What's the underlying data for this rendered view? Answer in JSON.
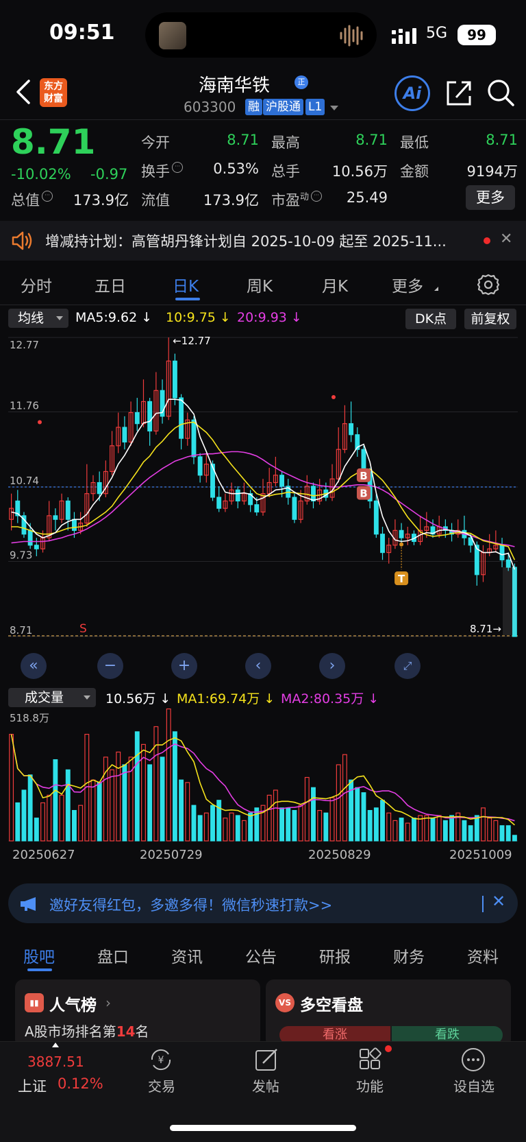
{
  "status_bar": {
    "time": "09:51",
    "network": "5G",
    "battery": "99"
  },
  "header": {
    "logo_text_1": "东方",
    "logo_text_2": "财富",
    "stock_name": "海南华铁",
    "name_badge": "正",
    "stock_code": "603300",
    "tags": [
      "融",
      "沪股通",
      "L1"
    ],
    "ai_label": "Ai"
  },
  "quote": {
    "price": "8.71",
    "change_pct": "-10.02%",
    "change": "-0.97",
    "fields": [
      {
        "label": "今开",
        "value": "8.71",
        "color": "green"
      },
      {
        "label": "最高",
        "value": "8.71",
        "color": "green"
      },
      {
        "label": "最低",
        "value": "8.71",
        "color": "green"
      },
      {
        "label": "换手",
        "value": "0.53%",
        "color": "white"
      },
      {
        "label": "总手",
        "value": "10.56万",
        "color": "white"
      },
      {
        "label": "金额",
        "value": "9194万",
        "color": "white"
      },
      {
        "label": "总值",
        "value": "173.9亿",
        "color": "white"
      },
      {
        "label": "流值",
        "value": "173.9亿",
        "color": "white"
      },
      {
        "label": "市盈",
        "label_sup": "动",
        "value": "25.49",
        "color": "white"
      }
    ],
    "more_label": "更多"
  },
  "notice": {
    "text": "增减持计划：高管胡丹锋计划自 2025-10-09 起至 2025-11..."
  },
  "period_tabs": [
    "分时",
    "五日",
    "日K",
    "周K",
    "月K",
    "更多"
  ],
  "active_period": "日K",
  "ma_bar": {
    "selector": "均线",
    "ma5": "MA5:9.62 ↓",
    "ma10": "10:9.75 ↓",
    "ma20": "20:9.93 ↓",
    "dk": "DK点",
    "adjust": "前复权"
  },
  "chart_data": {
    "type": "candlestick",
    "y_ticks": [
      "12.77",
      "11.76",
      "10.74",
      "9.73",
      "8.71"
    ],
    "ylim": [
      8.71,
      12.77
    ],
    "ref_price": 10.74,
    "high_marker": "←12.77",
    "last_marker": "8.71→",
    "dates": [
      "20250627",
      "20250729",
      "20250829",
      "20251009"
    ],
    "candles": [
      [
        10.3,
        10.45,
        10.65,
        10.15
      ],
      [
        10.55,
        10.35,
        10.7,
        10.25
      ],
      [
        10.35,
        10.1,
        10.4,
        10.05
      ],
      [
        10.15,
        9.95,
        10.25,
        9.9
      ],
      [
        9.95,
        9.9,
        10.05,
        9.8
      ],
      [
        9.9,
        10.05,
        10.15,
        9.85
      ],
      [
        10.05,
        10.35,
        10.55,
        10.0
      ],
      [
        10.35,
        10.3,
        10.45,
        10.15
      ],
      [
        10.3,
        10.55,
        10.65,
        10.25
      ],
      [
        10.55,
        10.3,
        10.6,
        10.15
      ],
      [
        10.3,
        10.15,
        10.4,
        10.05
      ],
      [
        10.15,
        10.25,
        10.4,
        10.1
      ],
      [
        10.25,
        10.65,
        11.05,
        10.2
      ],
      [
        10.65,
        10.8,
        10.9,
        10.55
      ],
      [
        10.8,
        10.65,
        10.95,
        10.55
      ],
      [
        10.65,
        10.95,
        11.1,
        10.6
      ],
      [
        10.95,
        11.3,
        11.5,
        10.9
      ],
      [
        11.3,
        11.55,
        11.75,
        11.2
      ],
      [
        11.55,
        11.35,
        11.7,
        11.25
      ],
      [
        11.35,
        11.75,
        11.9,
        11.3
      ],
      [
        11.75,
        11.6,
        11.95,
        11.5
      ],
      [
        11.6,
        11.9,
        12.2,
        11.55
      ],
      [
        11.9,
        11.5,
        11.95,
        11.3
      ],
      [
        11.5,
        12.05,
        12.3,
        11.45
      ],
      [
        12.05,
        11.7,
        12.2,
        11.6
      ],
      [
        11.7,
        12.45,
        12.77,
        11.65
      ],
      [
        12.45,
        11.95,
        12.55,
        11.85
      ],
      [
        11.95,
        11.4,
        12.0,
        11.25
      ],
      [
        11.4,
        11.65,
        11.75,
        11.3
      ],
      [
        11.65,
        11.15,
        11.7,
        11.05
      ],
      [
        11.15,
        10.9,
        11.2,
        10.8
      ],
      [
        10.9,
        11.05,
        11.2,
        10.8
      ],
      [
        11.05,
        10.6,
        11.1,
        10.55
      ],
      [
        10.6,
        10.45,
        10.75,
        10.4
      ],
      [
        10.45,
        10.55,
        10.65,
        10.4
      ],
      [
        10.55,
        10.7,
        10.8,
        10.5
      ],
      [
        10.7,
        10.55,
        10.75,
        10.45
      ],
      [
        10.55,
        10.65,
        10.8,
        10.5
      ],
      [
        10.65,
        10.5,
        10.7,
        10.4
      ],
      [
        10.5,
        10.4,
        10.6,
        10.35
      ],
      [
        10.4,
        10.65,
        10.85,
        10.35
      ],
      [
        10.65,
        10.8,
        11.0,
        10.6
      ],
      [
        10.8,
        10.9,
        11.15,
        10.75
      ],
      [
        10.9,
        10.75,
        10.95,
        10.6
      ],
      [
        10.75,
        10.6,
        10.85,
        10.5
      ],
      [
        10.6,
        10.3,
        10.65,
        10.25
      ],
      [
        10.3,
        10.55,
        10.7,
        10.25
      ],
      [
        10.55,
        10.75,
        10.9,
        10.5
      ],
      [
        10.75,
        10.55,
        10.8,
        10.45
      ],
      [
        10.55,
        10.7,
        10.85,
        10.5
      ],
      [
        10.7,
        10.6,
        10.8,
        10.55
      ],
      [
        10.6,
        10.85,
        11.05,
        10.55
      ],
      [
        10.85,
        11.25,
        11.55,
        10.8
      ],
      [
        11.25,
        11.6,
        11.85,
        11.2
      ],
      [
        11.6,
        11.45,
        11.9,
        11.35
      ],
      [
        11.45,
        11.25,
        11.55,
        11.15
      ],
      [
        11.25,
        10.95,
        11.3,
        10.85
      ],
      [
        10.95,
        10.55,
        11.0,
        10.45
      ],
      [
        10.55,
        10.1,
        10.65,
        10.05
      ],
      [
        10.1,
        9.85,
        10.2,
        9.75
      ],
      [
        9.85,
        9.95,
        10.05,
        9.7
      ],
      [
        9.95,
        10.15,
        10.3,
        9.9
      ],
      [
        10.15,
        10.05,
        10.25,
        9.95
      ],
      [
        10.05,
        10.1,
        10.2,
        9.95
      ],
      [
        10.1,
        10.0,
        10.15,
        9.95
      ],
      [
        10.0,
        10.15,
        10.35,
        9.95
      ],
      [
        10.15,
        10.2,
        10.4,
        10.05
      ],
      [
        10.2,
        10.1,
        10.3,
        10.05
      ],
      [
        10.1,
        10.2,
        10.35,
        10.05
      ],
      [
        10.2,
        10.15,
        10.3,
        10.05
      ],
      [
        10.15,
        10.1,
        10.25,
        10.0
      ],
      [
        10.1,
        10.15,
        10.3,
        10.05
      ],
      [
        10.15,
        10.05,
        10.35,
        9.95
      ],
      [
        10.05,
        9.95,
        10.1,
        9.85
      ],
      [
        9.95,
        9.55,
        10.0,
        9.4
      ],
      [
        9.55,
        9.85,
        9.95,
        9.45
      ],
      [
        9.85,
        9.9,
        10.1,
        9.8
      ],
      [
        9.9,
        9.95,
        10.15,
        9.85
      ],
      [
        9.95,
        9.75,
        10.05,
        9.65
      ],
      [
        9.75,
        9.65,
        9.85,
        9.6
      ],
      [
        9.65,
        8.71,
        9.7,
        8.71
      ]
    ],
    "ma5": [
      10.4,
      10.38,
      10.3,
      10.2,
      10.1,
      10.05,
      10.08,
      10.12,
      10.22,
      10.27,
      10.3,
      10.3,
      10.37,
      10.5,
      10.6,
      10.73,
      10.87,
      11.05,
      11.17,
      11.32,
      11.48,
      11.61,
      11.63,
      11.74,
      11.75,
      11.93,
      11.93,
      11.92,
      11.84,
      11.73,
      11.42,
      11.22,
      11.01,
      10.82,
      10.67,
      10.65,
      10.65,
      10.66,
      10.64,
      10.56,
      10.59,
      10.64,
      10.7,
      10.71,
      10.73,
      10.67,
      10.62,
      10.59,
      10.56,
      10.58,
      10.63,
      10.69,
      10.82,
      11.02,
      11.15,
      11.28,
      11.32,
      11.08,
      10.66,
      10.34,
      10.14,
      10.02,
      10.0,
      10.01,
      10.04,
      10.09,
      10.12,
      10.11,
      10.15,
      10.16,
      10.15,
      10.14,
      10.12,
      10.08,
      9.9,
      9.85,
      9.85,
      9.86,
      9.82,
      9.84,
      9.62
    ],
    "ma10": [
      10.2,
      10.2,
      10.18,
      10.15,
      10.12,
      10.1,
      10.1,
      10.12,
      10.15,
      10.18,
      10.19,
      10.2,
      10.22,
      10.28,
      10.34,
      10.4,
      10.48,
      10.6,
      10.71,
      10.83,
      10.95,
      11.08,
      11.16,
      11.28,
      11.36,
      11.46,
      11.54,
      11.59,
      11.61,
      11.62,
      11.55,
      11.48,
      11.38,
      11.25,
      11.15,
      11.04,
      10.94,
      10.84,
      10.74,
      10.65,
      10.62,
      10.62,
      10.64,
      10.65,
      10.67,
      10.66,
      10.65,
      10.64,
      10.62,
      10.63,
      10.65,
      10.67,
      10.72,
      10.8,
      10.88,
      10.93,
      10.98,
      10.98,
      10.91,
      10.83,
      10.72,
      10.6,
      10.46,
      10.33,
      10.23,
      10.13,
      10.09,
      10.07,
      10.08,
      10.09,
      10.11,
      10.12,
      10.12,
      10.11,
      10.06,
      10.01,
      9.99,
      9.97,
      9.95,
      9.93,
      9.75
    ],
    "ma20": [
      9.98,
      9.99,
      10.0,
      10.0,
      10.0,
      10.0,
      10.01,
      10.03,
      10.05,
      10.08,
      10.1,
      10.13,
      10.17,
      10.22,
      10.27,
      10.33,
      10.4,
      10.48,
      10.56,
      10.64,
      10.72,
      10.8,
      10.87,
      10.93,
      10.99,
      11.04,
      11.09,
      11.12,
      11.15,
      11.17,
      11.18,
      11.19,
      11.19,
      11.2,
      11.21,
      11.22,
      11.22,
      11.21,
      11.19,
      11.16,
      11.11,
      11.05,
      11.0,
      10.95,
      10.91,
      10.87,
      10.83,
      10.8,
      10.78,
      10.76,
      10.75,
      10.74,
      10.74,
      10.75,
      10.76,
      10.77,
      10.77,
      10.76,
      10.74,
      10.7,
      10.65,
      10.58,
      10.52,
      10.46,
      10.4,
      10.34,
      10.29,
      10.24,
      10.2,
      10.17,
      10.14,
      10.12,
      10.1,
      10.08,
      10.05,
      10.02,
      10.0,
      9.98,
      9.96,
      9.95,
      9.93
    ]
  },
  "volume_bar": {
    "selector": "成交量",
    "vol": "10.56万 ↓",
    "ma1": "MA1:69.74万 ↓",
    "ma2": "MA2:80.35万 ↓",
    "y_max_label": "518.8万"
  },
  "volume_data": {
    "ymax": 518.8,
    "values": [
      420,
      150,
      200,
      260,
      90,
      150,
      180,
      320,
      180,
      280,
      120,
      140,
      420,
      240,
      230,
      330,
      280,
      350,
      300,
      330,
      430,
      380,
      300,
      450,
      330,
      520,
      430,
      240,
      230,
      140,
      100,
      110,
      140,
      160,
      90,
      110,
      100,
      80,
      110,
      130,
      140,
      180,
      200,
      130,
      130,
      120,
      140,
      250,
      210,
      120,
      110,
      170,
      300,
      340,
      240,
      210,
      190,
      120,
      130,
      160,
      110,
      80,
      90,
      70,
      90,
      100,
      100,
      90,
      100,
      80,
      100,
      110,
      80,
      60,
      100,
      130,
      90,
      80,
      60,
      60,
      22
    ]
  },
  "promo": {
    "text": "邀好友得红包，多邀多得！微信秒速打款>>"
  },
  "bottom_tabs": [
    "股吧",
    "盘口",
    "资讯",
    "公告",
    "研报",
    "财务",
    "资料"
  ],
  "cards": {
    "popular_title": "人气榜",
    "popular_sub_pre": "A股市场排名第",
    "popular_rank": "14",
    "popular_sub_post": "名",
    "vs_title": "多空看盘",
    "vs_icon": "VS",
    "bull": "看涨",
    "bear": "看跌"
  },
  "bottom_nav": {
    "index_value": "3887.51",
    "index_name": "上证",
    "index_pct": "0.12%",
    "items": [
      "交易",
      "发帖",
      "功能",
      "设自选"
    ]
  },
  "colors": {
    "up": "#f03c3c",
    "down": "#2ee0e8",
    "green": "#2ed15a",
    "accent": "#3d7ee9",
    "ma5": "#ffffff",
    "ma10": "#f5e21c",
    "ma20": "#e43ee4"
  }
}
